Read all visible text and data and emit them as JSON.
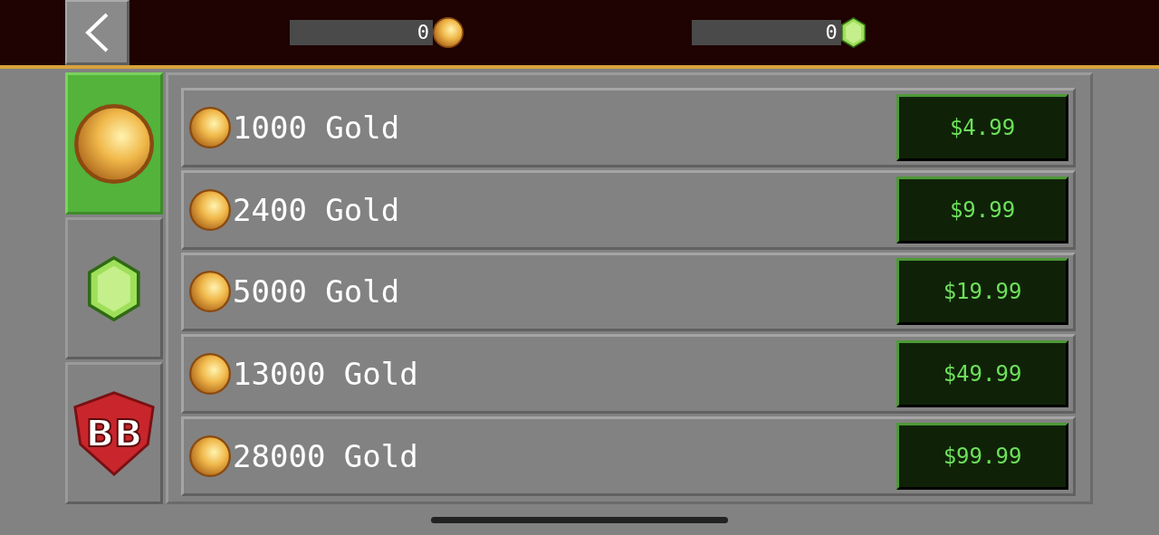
{
  "top_bar": {
    "balances": [
      {
        "kind": "gold",
        "amount": "0"
      },
      {
        "kind": "gem",
        "amount": "0"
      }
    ]
  },
  "category_tabs": [
    {
      "kind": "gold",
      "selected": true
    },
    {
      "kind": "gem",
      "selected": false
    },
    {
      "kind": "logo",
      "text": "BB",
      "selected": false
    }
  ],
  "offers": [
    {
      "label": "1000 Gold",
      "price": "$4.99"
    },
    {
      "label": "2400 Gold",
      "price": "$9.99"
    },
    {
      "label": "5000 Gold",
      "price": "$19.99"
    },
    {
      "label": "13000 Gold",
      "price": "$49.99"
    },
    {
      "label": "28000 Gold",
      "price": "$99.99"
    }
  ]
}
